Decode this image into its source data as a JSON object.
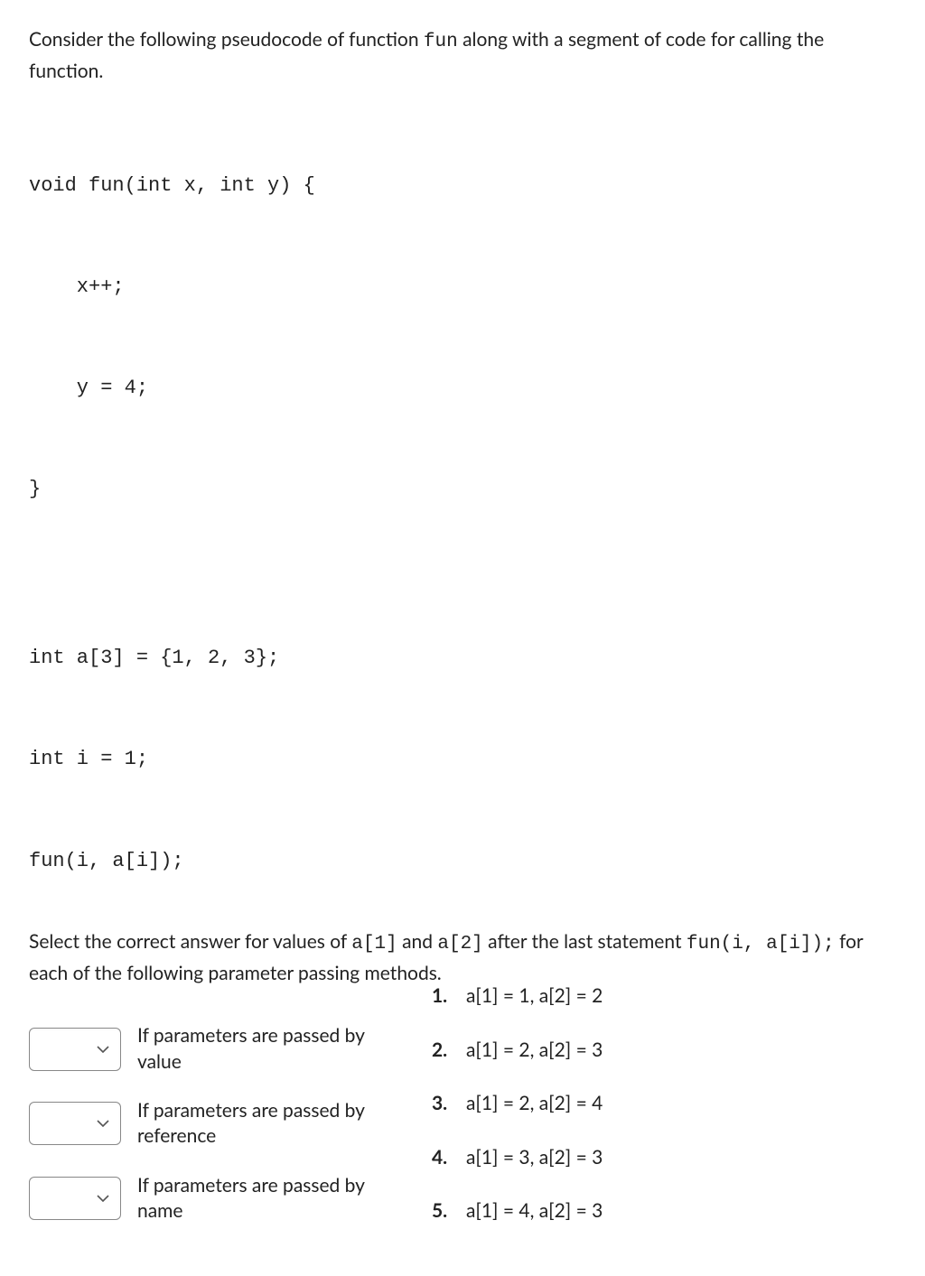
{
  "intro_text_pre": "Consider the following pseudocode of function ",
  "intro_code": "fun",
  "intro_text_post": " along with a segment of code for calling the function.",
  "code_lines": [
    "void fun(int x, int y) {",
    "    x++;",
    "    y = 4;",
    "}",
    "",
    "int a[3] = {1, 2, 3};",
    "int i = 1;",
    "fun(i, a[i]);"
  ],
  "instruction": {
    "part1": "Select the correct answer for values of ",
    "code1": "a[1]",
    "part2": " and ",
    "code2": "a[2]",
    "part3": " after the last statement ",
    "code3": "fun(i, a[i]);",
    "part4": " for each of the following parameter passing methods."
  },
  "match_items": [
    {
      "label": "If parameters are passed by value"
    },
    {
      "label": "If parameters are passed by reference"
    },
    {
      "label": "If parameters are passed by name"
    }
  ],
  "answers": [
    {
      "num": "1.",
      "text": "a[1] = 1, a[2] = 2"
    },
    {
      "num": "2.",
      "text": "a[1] = 2, a[2] = 3"
    },
    {
      "num": "3.",
      "text": "a[1] = 2, a[2] = 4"
    },
    {
      "num": "4.",
      "text": "a[1] = 3, a[2] = 3"
    },
    {
      "num": "5.",
      "text": "a[1] = 4, a[2] = 3"
    }
  ]
}
